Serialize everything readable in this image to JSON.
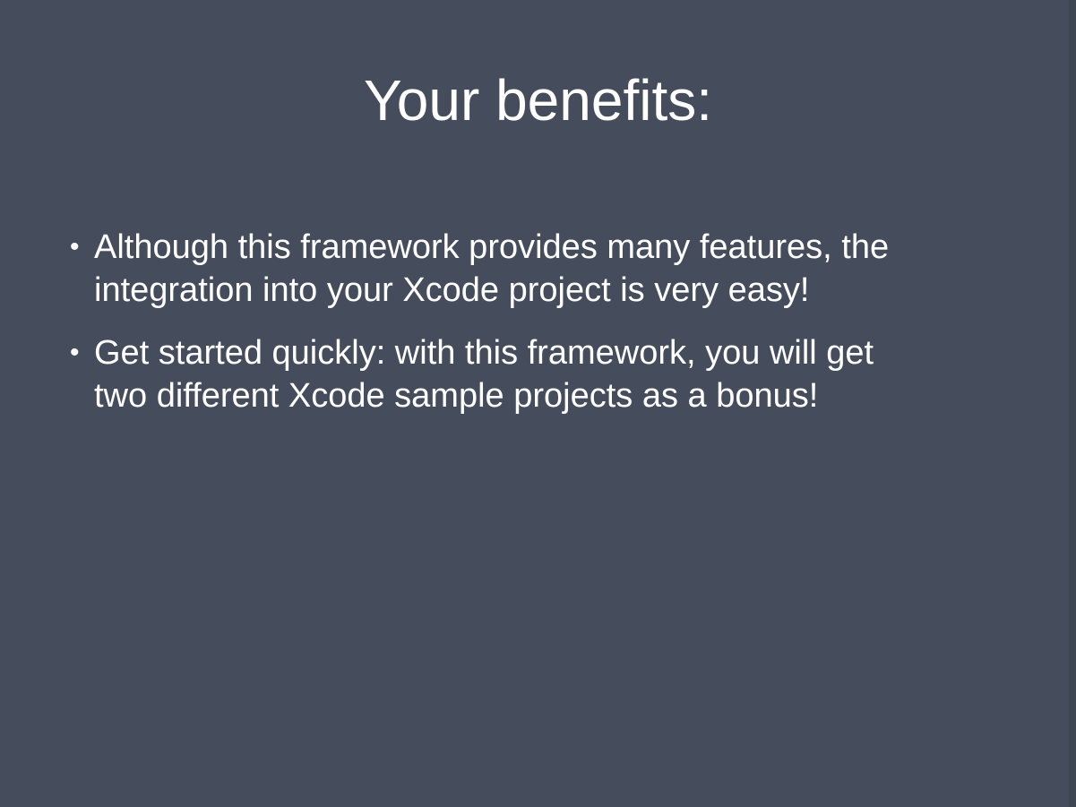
{
  "slide": {
    "title": "Your benefits:",
    "bullet_symbol": "•",
    "bullets": [
      {
        "line1": "Although this framework provides many features, the",
        "line2": "integration into your Xcode project is very easy!"
      },
      {
        "line1": "Get started quickly: with this framework, you will get",
        "line2": "two different Xcode sample projects as a bonus!"
      }
    ]
  },
  "colors": {
    "background": "#454d5c",
    "text": "#ffffff"
  }
}
